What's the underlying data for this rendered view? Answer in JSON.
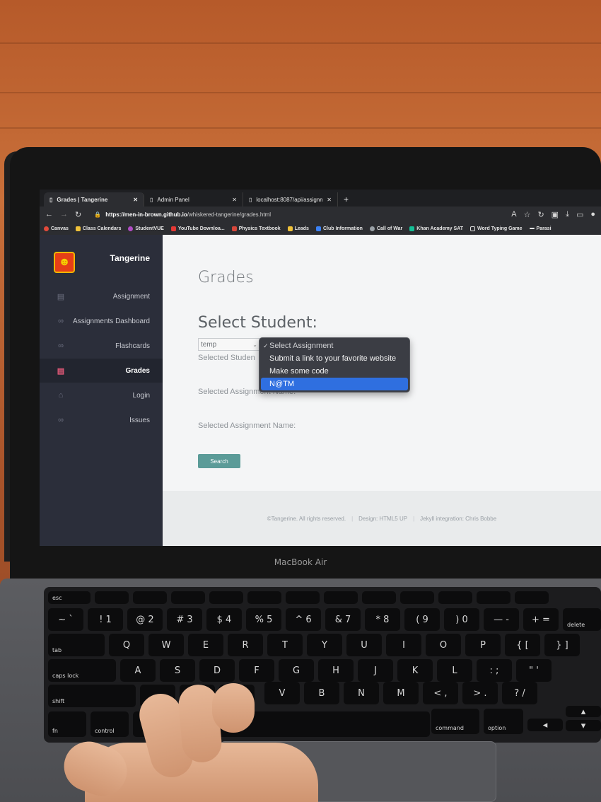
{
  "browser": {
    "tabs": [
      {
        "label": "Grades | Tangerine",
        "active": true
      },
      {
        "label": "Admin Panel",
        "active": false
      },
      {
        "label": "localhost:8087/api/assignmen",
        "active": false
      }
    ],
    "url_domain": "https://men-in-brown.github.io",
    "url_path": "/whiskered-tangerine/grades.html",
    "bookmarks": [
      {
        "label": "Canvas",
        "color": "#e24a3b"
      },
      {
        "label": "Class Calendars",
        "color": "#f0c23a"
      },
      {
        "label": "StudentVUE",
        "color": "#b04cc4"
      },
      {
        "label": "YouTube Downloa...",
        "color": "#e53935"
      },
      {
        "label": "Physics Textbook",
        "color": "#d7473b"
      },
      {
        "label": "Leads",
        "color": "#f0c23a"
      },
      {
        "label": "Club Information",
        "color": "#3b82f6"
      },
      {
        "label": "Call of War",
        "color": "#9aa0a6"
      },
      {
        "label": "Khan Academy SAT",
        "color": "#14bf96"
      },
      {
        "label": "Word Typing Game",
        "color": "#e6e6e6"
      },
      {
        "label": "Parasi",
        "color": "#e6e6e6"
      }
    ]
  },
  "site": {
    "name": "Tangerine",
    "nav": [
      {
        "label": "Assignment",
        "icon": "book-icon"
      },
      {
        "label": "Assignments Dashboard",
        "icon": "link-icon"
      },
      {
        "label": "Flashcards",
        "icon": "link-icon"
      },
      {
        "label": "Grades",
        "icon": "book-icon",
        "active": true
      },
      {
        "label": "Login",
        "icon": "home-icon"
      },
      {
        "label": "Issues",
        "icon": "link-icon"
      }
    ]
  },
  "page": {
    "title": "Grades",
    "select_student_heading": "Select Student:",
    "student_select_value": "temp",
    "selected_student_label": "Selected Studen",
    "selected_assignment_label_1": "Selected Assignment Name:",
    "selected_assignment_label_2": "Selected Assignment Name:",
    "search_button": "Search"
  },
  "assignment_dropdown": {
    "options": [
      "Select Assignment",
      "Submit a link to your favorite website",
      "Make some code",
      "N@TM"
    ],
    "checked_index": 0,
    "highlighted_index": 3
  },
  "footer": {
    "copyright": "©Tangerine. All rights reserved.",
    "design": "Design: HTML5 UP",
    "jekyll": "Jekyll integration: Chris Bobbe"
  },
  "device": {
    "brand": "MacBook Air"
  },
  "keyboard": {
    "row_num": [
      "~ `",
      "! 1",
      "@ 2",
      "# 3",
      "$ 4",
      "% 5",
      "^ 6",
      "& 7",
      "* 8",
      "( 9",
      ") 0",
      "— -",
      "+ ="
    ],
    "row_q": [
      "Q",
      "W",
      "E",
      "R",
      "T",
      "Y",
      "U",
      "I",
      "O",
      "P",
      "{ [",
      "} ]"
    ],
    "row_a": [
      "A",
      "S",
      "D",
      "F",
      "G",
      "H",
      "J",
      "K",
      "L",
      ": ;",
      "\" '"
    ],
    "row_z": [
      "V",
      "B",
      "N",
      "M",
      "< ,",
      "> .",
      "? /"
    ],
    "labels": {
      "esc": "esc",
      "tab": "tab",
      "caps": "caps lock",
      "shift": "shift",
      "fn": "fn",
      "control": "control",
      "command": "command",
      "option": "option",
      "delete": "delete"
    }
  }
}
